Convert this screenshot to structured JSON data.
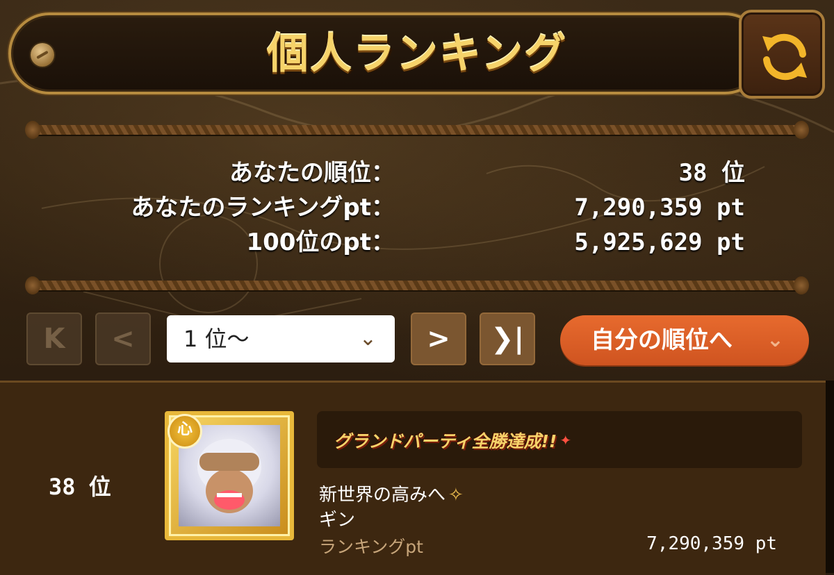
{
  "header": {
    "title": "個人ランキング",
    "refresh_icon": "refresh-icon"
  },
  "stats": {
    "my_rank_label": "あなたの順位：",
    "my_rank_value": "38 位",
    "my_points_label": "あなたのランキングpt：",
    "my_points_value": "7,290,359 pt",
    "rank100_label": "100位のpt：",
    "rank100_value": "5,925,629 pt"
  },
  "pagination": {
    "first_icon": "first-page-icon",
    "prev_icon": "prev-page-icon",
    "next_icon": "next-page-icon",
    "last_icon": "last-page-icon",
    "selected_range": "1 位〜",
    "my_rank_button": "自分の順位へ"
  },
  "entries": [
    {
      "rank": "38 位",
      "badge_text": "グランドパーティ全勝達成!!",
      "attribute": "心",
      "title": "新世界の高みへ",
      "name": "ギン",
      "points_label": "ランキングpt",
      "points": "7,290,359 pt"
    }
  ],
  "colors": {
    "accent_orange": "#d95d24",
    "gold": "#f6d36a",
    "panel_brown": "#3d2710"
  }
}
